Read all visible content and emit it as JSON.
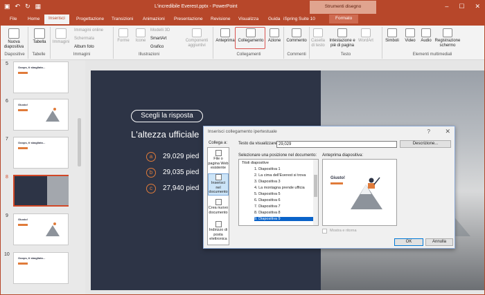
{
  "window": {
    "title": "L'incredibile Everest.pptx - PowerPoint",
    "context_group": "Strumenti disegno"
  },
  "tabs": [
    "File",
    "Home",
    "Inserisci",
    "Progettazione",
    "Transizioni",
    "Animazioni",
    "Presentazione",
    "Revisione",
    "Visualizza",
    "Guida",
    "iSpring Suite 10",
    "Formato"
  ],
  "ribbon": {
    "nuova_diapositiva": "Nuova diapositiva",
    "tabella": "Tabella",
    "immagini": "Immagini",
    "immagini_online": "Immagini online",
    "schermata": "Schermata",
    "album_foto": "Album foto",
    "forme": "Forme",
    "icone": "Icone",
    "modelli_3d": "Modelli 3D",
    "smartart": "SmartArt",
    "grafico": "Grafico",
    "componenti": "Componenti aggiuntivi",
    "anteprima": "Anteprima",
    "collegamento": "Collegamento",
    "azione": "Azione",
    "commento": "Commento",
    "casella": "Casella di testo",
    "intestazione": "Intestazione e piè di pagina",
    "wordart": "WordArt",
    "simboli": "Simboli",
    "video": "Video",
    "audio": "Audio",
    "registrazione": "Registrazione schermo",
    "groups": {
      "diapositive": "Diapositive",
      "tabelle": "Tabelle",
      "immagini": "Immagini",
      "illustrazioni": "Illustrazioni",
      "collegamenti": "Collegamenti",
      "commenti": "Commenti",
      "testo": "Testo",
      "multimediali": "Elementi multimediali"
    }
  },
  "slides": [
    {
      "num": "5",
      "title": "Ooops, ti sbagliato..."
    },
    {
      "num": "6",
      "title": "Giusto!"
    },
    {
      "num": "7",
      "title": "Ooops, ti sbagliato..."
    },
    {
      "num": "8",
      "title": ""
    },
    {
      "num": "9",
      "title": "Giusto!"
    },
    {
      "num": "10",
      "title": "Ooops, ti sbagliato..."
    }
  ],
  "slide": {
    "pill": "Scegli la risposta",
    "question": "L'altezza ufficiale",
    "options": [
      {
        "letter": "a",
        "text": "29,029 pied"
      },
      {
        "letter": "b",
        "text": "29,035 pied"
      },
      {
        "letter": "c",
        "text": "27,940 pied"
      }
    ]
  },
  "dialog": {
    "title": "Inserisci collegamento ipertestuale",
    "help": "?",
    "close": "✕",
    "collega_a": "Collega a:",
    "link_options": [
      "File o pagina Web esistente",
      "Inserisci nel documento",
      "Crea nuovo documento",
      "Indirizzo di posta elettronica"
    ],
    "testo_label": "Testo da visualizzare:",
    "testo_value": "29,029",
    "descrizione": "Descrizione...",
    "select_label": "Selezionare una posizione nel documento:",
    "preview_label": "Anteprima diapositiva:",
    "tree": [
      "Titoli diapositive",
      "1. Diapositiva 1",
      "2. La cima dell'Everest si trova",
      "3. Diapositiva 3",
      "4. La montagna prende ufficia",
      "5. Diapositiva 5",
      "6. Diapositiva 6",
      "7. Diapositiva 7",
      "8. Diapositiva 8",
      "9. Diapositiva 9"
    ],
    "preview_title": "Giusto!",
    "mostra": "Mostra e ritorna",
    "ok": "OK",
    "annulla": "Annulla"
  },
  "colors": {
    "accent": "#b7472a",
    "orange": "#e07b3a",
    "selection": "#0a63c9"
  }
}
